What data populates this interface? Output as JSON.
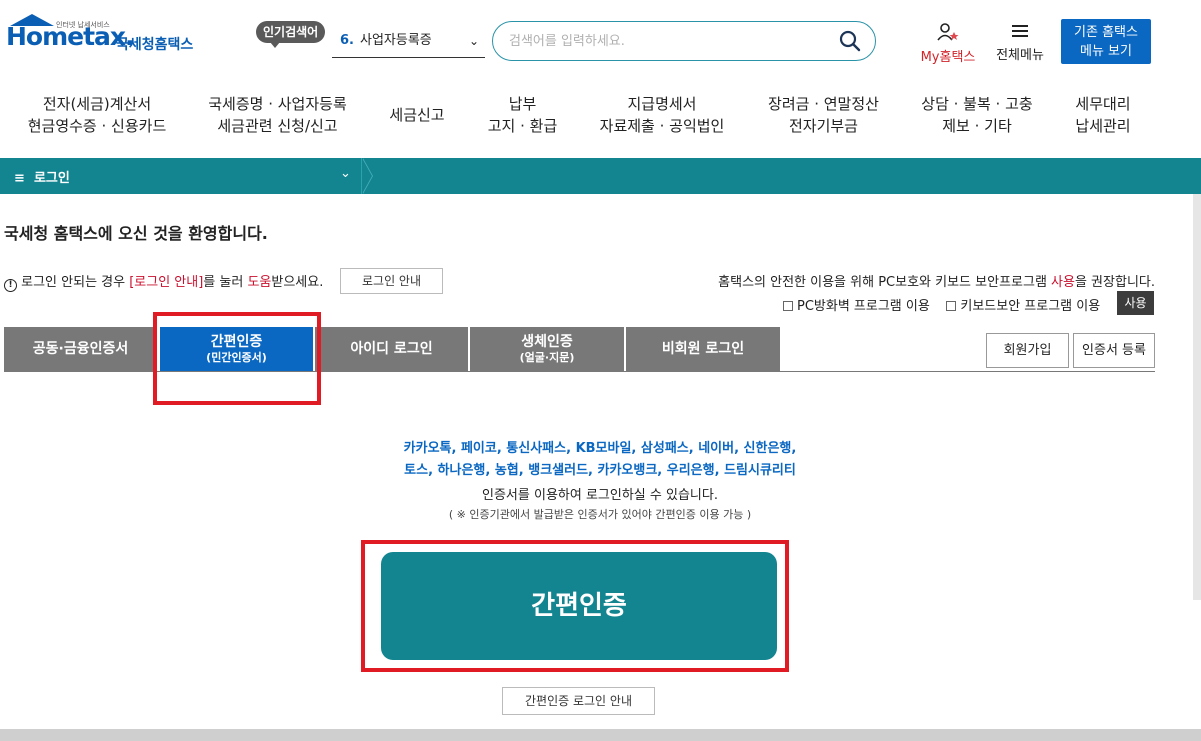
{
  "header": {
    "logo_text": "Hometax.",
    "logo_tagline": "인터넷 납세서비스",
    "logo_nts": "국세청홈택스",
    "popular_badge": "인기검색어",
    "popular_num": "6.",
    "popular_value": "사업자등록증",
    "search_placeholder": "검색어를 입력하세요.",
    "my_hometax": "My홈택스",
    "all_menu": "전체메뉴",
    "legacy_line1": "기존 홈택스",
    "legacy_line2": "메뉴 보기"
  },
  "nav": [
    {
      "l1": "전자(세금)계산서",
      "l2": "현금영수증 · 신용카드"
    },
    {
      "l1": "국세증명 · 사업자등록",
      "l2": "세금관련 신청/신고"
    },
    {
      "l1": "세금신고",
      "l2": ""
    },
    {
      "l1": "납부",
      "l2": "고지 · 환급"
    },
    {
      "l1": "지급명세서",
      "l2": "자료제출 · 공익법인"
    },
    {
      "l1": "장려금 · 연말정산",
      "l2": "전자기부금"
    },
    {
      "l1": "상담 · 불복 · 고충",
      "l2": "제보 · 기타"
    },
    {
      "l1": "세무대리",
      "l2": "납세관리"
    }
  ],
  "location": {
    "icon": "≡",
    "label": "로그인"
  },
  "welcome": "국세청 홈택스에 오신 것을 환영합니다.",
  "notice": {
    "pre": "로그인 안되는 경우 ",
    "link": "[로그인 안내]",
    "mid": "를 눌러 ",
    "help": "도움",
    "post": "받으세요.",
    "button": "로그인 안내"
  },
  "security": {
    "pre": "홈택스의 안전한 이용을 위해 PC보호와 키보드 보안프로그램 ",
    "use": "사용",
    "post": "을 권장합니다.",
    "chk1": "PC방화벽 프로그램 이용",
    "chk2": "키보드보안 프로그램 이용",
    "use_button": "사용"
  },
  "tabs": [
    {
      "label": "공동·금융인증서",
      "sub": ""
    },
    {
      "label": "간편인증",
      "sub": "(민간인증서)"
    },
    {
      "label": "아이디 로그인",
      "sub": ""
    },
    {
      "label": "생체인증",
      "sub": "(얼굴·지문)"
    },
    {
      "label": "비회원 로그인",
      "sub": ""
    }
  ],
  "join_button": "회원가입",
  "cert_register_button": "인증서 등록",
  "providers": {
    "line1": "카카오톡, 페이코, 통신사패스, KB모바일, 삼성패스, 네이버, 신한은행,",
    "line2": "토스, 하나은행, 농협, 뱅크샐러드, 카카오뱅크, 우리은행, 드림시큐리티",
    "note": "인증서를 이용하여 로그인하실 수 있습니다.",
    "sub": "( ※ 인증기관에서 발급받은 인증서가 있어야 간편인증 이용 가능 )"
  },
  "main_button": "간편인증",
  "guide_button": "간편인증 로그인 안내",
  "colors": {
    "teal": "#138590",
    "blue": "#0a67c2",
    "red": "#e01b24"
  }
}
